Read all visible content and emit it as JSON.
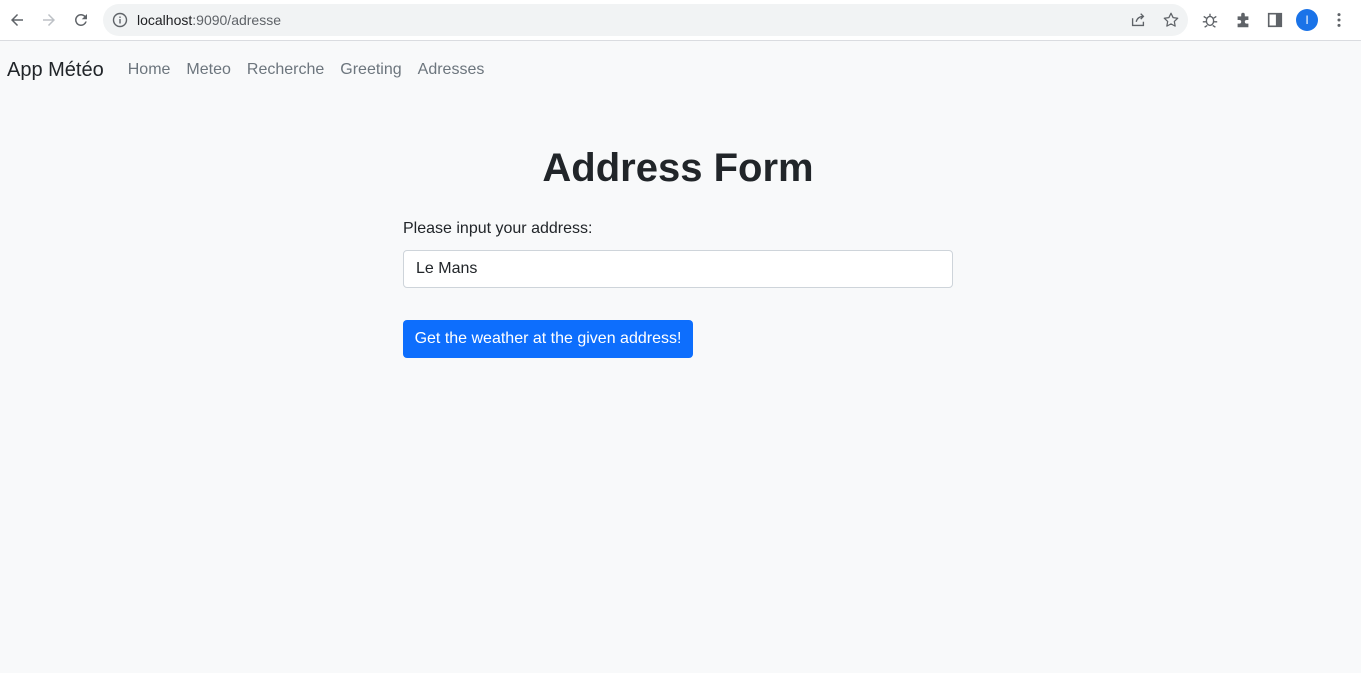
{
  "browser": {
    "url_host": "localhost",
    "url_path": ":9090/adresse",
    "profile_initial": "I"
  },
  "navbar": {
    "brand": "App Météo",
    "links": [
      "Home",
      "Meteo",
      "Recherche",
      "Greeting",
      "Adresses"
    ]
  },
  "form": {
    "title": "Address Form",
    "label": "Please input your address:",
    "address_value": "Le Mans",
    "submit_label": "Get the weather at the given address!"
  },
  "colors": {
    "primary": "#0d6efd",
    "background": "#f8f9fa",
    "nav_link": "#6c757d"
  }
}
